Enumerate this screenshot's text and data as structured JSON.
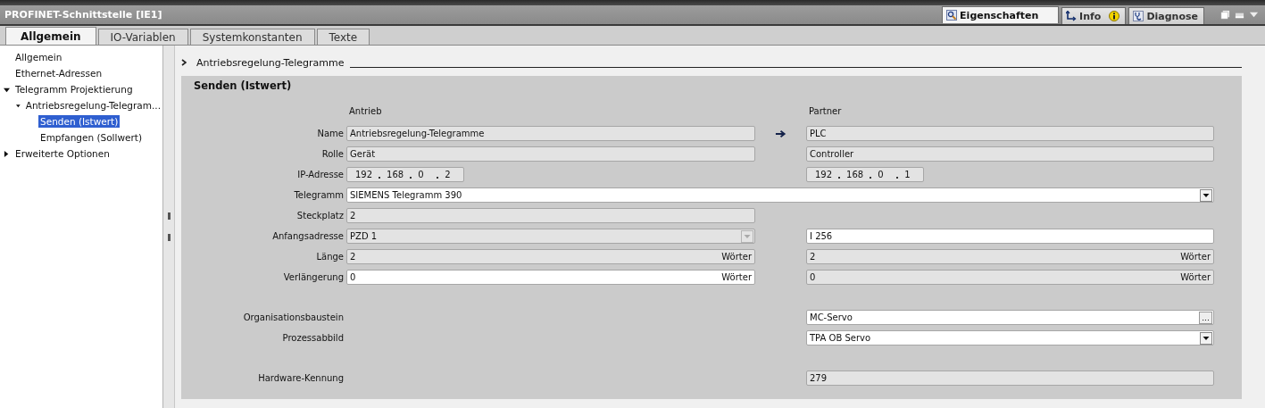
{
  "window": {
    "title": "PROFINET-Schnittstelle [IE1]"
  },
  "inspector_tabs": [
    {
      "label": "Eigenschaften",
      "selected": true,
      "notice": false
    },
    {
      "label": "Info",
      "selected": false,
      "notice": true
    },
    {
      "label": "Diagnose",
      "selected": false,
      "notice": false
    }
  ],
  "tabs": [
    {
      "label": "Allgemein",
      "selected": true
    },
    {
      "label": "IO-Variablen",
      "selected": false
    },
    {
      "label": "Systemkonstanten",
      "selected": false
    },
    {
      "label": "Texte",
      "selected": false
    }
  ],
  "sidebar": {
    "items": [
      {
        "label": "Allgemein",
        "selected": false
      },
      {
        "label": "Ethernet-Adressen",
        "selected": false
      },
      {
        "label": "Telegramm Projektierung",
        "selected": false,
        "expanded": true,
        "children": [
          {
            "label": "Antriebsregelung-Telegram...",
            "selected": false,
            "expanded": true,
            "children": [
              {
                "label": "Senden (Istwert)",
                "selected": true
              },
              {
                "label": "Empfangen (Sollwert)",
                "selected": false
              }
            ]
          }
        ]
      },
      {
        "label": "Erweiterte Optionen",
        "selected": false,
        "expanded": false
      }
    ]
  },
  "section": {
    "title": "Antriebsregelung-Telegramme"
  },
  "panel": {
    "title": "Senden (Istwert)",
    "column_headings": [
      "Antrieb",
      "Partner"
    ],
    "groups": [
      [
        {
          "label": "Name",
          "arrow": true,
          "antrieb": {
            "kind": "readonly",
            "value": "Antriebsregelung-Telegramme"
          },
          "partner": {
            "kind": "readonly",
            "value": "PLC"
          }
        },
        {
          "label": "Rolle",
          "arrow": false,
          "antrieb": {
            "kind": "readonly",
            "value": "Gerät"
          },
          "partner": {
            "kind": "readonly",
            "value": "Controller"
          }
        },
        {
          "label": "IP-Adresse",
          "arrow": false,
          "antrieb": {
            "kind": "ip",
            "octets": [
              "192",
              "168",
              "0",
              "2"
            ]
          },
          "partner": {
            "kind": "ip",
            "octets": [
              "192",
              "168",
              "0",
              "1"
            ]
          }
        },
        {
          "label": "Telegramm",
          "arrow": false,
          "full_width": true,
          "antrieb": {
            "kind": "dropdown",
            "value": "SIEMENS Telegramm 390",
            "disabled": false
          }
        },
        {
          "label": "Steckplatz",
          "arrow": false,
          "antrieb": {
            "kind": "readonly",
            "value": "2"
          }
        },
        {
          "label": "Anfangsadresse",
          "arrow": false,
          "antrieb": {
            "kind": "dropdown",
            "value": "PZD 1",
            "disabled": true
          },
          "partner": {
            "kind": "input",
            "value": "I 256"
          }
        },
        {
          "label": "Länge",
          "arrow": false,
          "antrieb": {
            "kind": "readonly",
            "value": "2",
            "unit": "Wörter"
          },
          "partner": {
            "kind": "readonly",
            "value": "2",
            "unit": "Wörter"
          }
        },
        {
          "label": "Verlängerung",
          "arrow": false,
          "antrieb": {
            "kind": "input",
            "value": "0",
            "unit": "Wörter"
          },
          "partner": {
            "kind": "readonly",
            "value": "0",
            "unit": "Wörter"
          }
        }
      ],
      [
        {
          "label": "Organisationsbaustein",
          "arrow": false,
          "partner": {
            "kind": "browse",
            "value": "MC-Servo",
            "button_label": "..."
          }
        },
        {
          "label": "Prozessabbild",
          "arrow": false,
          "partner": {
            "kind": "dropdown",
            "value": "TPA OB Servo",
            "disabled": false
          }
        }
      ],
      [
        {
          "label": "Hardware-Kennung",
          "arrow": false,
          "partner": {
            "kind": "readonly",
            "value": "279"
          }
        }
      ]
    ]
  }
}
